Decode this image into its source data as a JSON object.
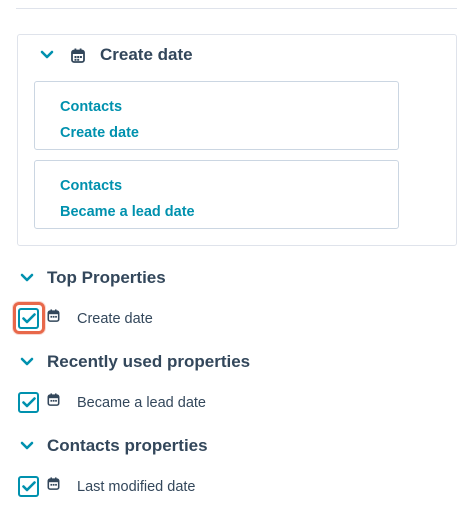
{
  "group": {
    "title": "Create date",
    "filters": [
      {
        "object": "Contacts",
        "property": "Create date"
      },
      {
        "object": "Contacts",
        "property": "Became a lead date"
      }
    ]
  },
  "sections": [
    {
      "title": "Top Properties",
      "items": [
        {
          "label": "Create date",
          "checked": true
        }
      ]
    },
    {
      "title": "Recently used properties",
      "items": [
        {
          "label": "Became a lead date",
          "checked": true
        }
      ]
    },
    {
      "title": "Contacts properties",
      "items": [
        {
          "label": "Last modified date",
          "checked": true
        }
      ]
    }
  ],
  "colors": {
    "accent": "#0091ae",
    "text": "#33475b",
    "border": "#dfe3eb",
    "highlight": "#e8684a"
  }
}
